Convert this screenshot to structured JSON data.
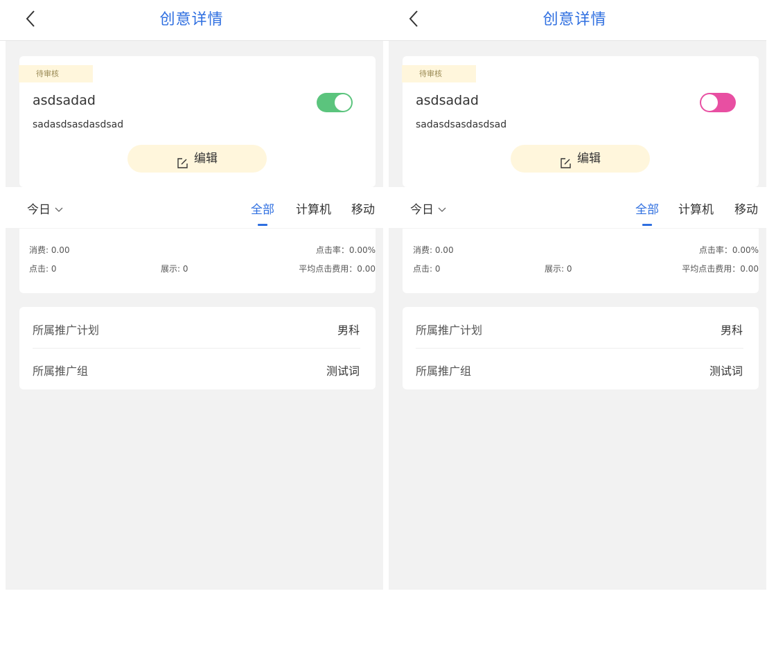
{
  "screens": [
    {
      "nav": {
        "title": "创意详情"
      },
      "creative": {
        "status": "待审核",
        "title": "asdsadad",
        "subtitle": "sadasdsasdasdsad",
        "toggle_color": "#5bc47d",
        "toggle_on": true,
        "edit_label": "编辑"
      },
      "filter": {
        "date": "今日",
        "tabs": [
          "全部",
          "计算机",
          "移动"
        ],
        "active_tab": "全部"
      },
      "stats": {
        "spend": "消费: 0.00",
        "ctr": "点击率：0.00%",
        "clicks": "点击: 0",
        "impressions": "展示: 0",
        "avg_cpc": "平均点击费用：0.00"
      },
      "info": [
        {
          "label": "所属推广计划",
          "value": "男科"
        },
        {
          "label": "所属推广组",
          "value": "测试词"
        }
      ]
    },
    {
      "nav": {
        "title": "创意详情"
      },
      "creative": {
        "status": "待审核",
        "title": "asdsadad",
        "subtitle": "sadasdsasdasdsad",
        "toggle_color": "#e84fa2",
        "toggle_on": false,
        "edit_label": "编辑"
      },
      "filter": {
        "date": "今日",
        "tabs": [
          "全部",
          "计算机",
          "移动"
        ],
        "active_tab": "全部"
      },
      "stats": {
        "spend": "消费: 0.00",
        "ctr": "点击率：0.00%",
        "clicks": "点击: 0",
        "impressions": "展示: 0",
        "avg_cpc": "平均点击费用：0.00"
      },
      "info": [
        {
          "label": "所属推广计划",
          "value": "男科"
        },
        {
          "label": "所属推广组",
          "value": "测试词"
        }
      ]
    }
  ],
  "colors": {
    "accent": "#2f6fe0",
    "badge_bg": "#fff6dc",
    "page_bg": "#f2f2f2"
  }
}
